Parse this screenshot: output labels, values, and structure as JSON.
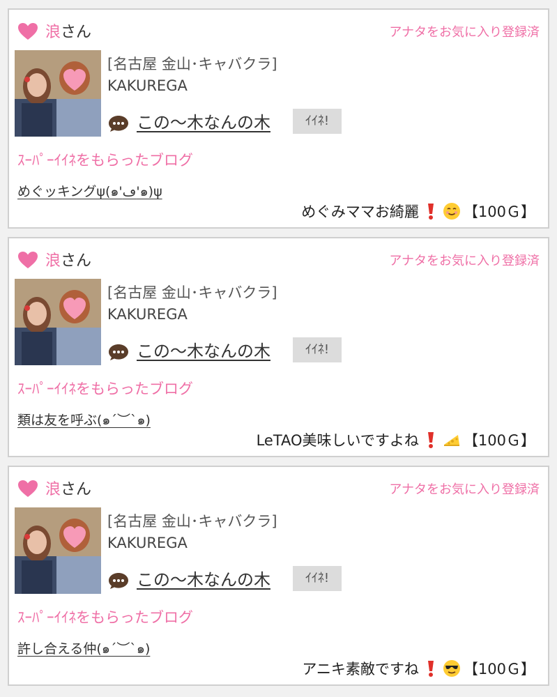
{
  "cards": [
    {
      "user_name": "浪",
      "user_suffix": "さん",
      "favorite_status": "アナタをお気に入り登録済",
      "shop_location": "[名古屋 金山･キャバクラ]",
      "shop_name": "KAKUREGA",
      "blog_title": "この〜木なんの木",
      "iine_label": "ｲｲﾈ!",
      "section_label": "ｽｰﾊﾟｰｲｲﾈをもらったブログ",
      "article_title": "めぐッキングψ(๑'ڡ'๑)ψ",
      "comment_text": "めぐみママお綺麗",
      "emoji_icons": [
        "heavy-exclamation-mark-icon",
        "smiling-face-icon"
      ],
      "points": "【100Ｇ】"
    },
    {
      "user_name": "浪",
      "user_suffix": "さん",
      "favorite_status": "アナタをお気に入り登録済",
      "shop_location": "[名古屋 金山･キャバクラ]",
      "shop_name": "KAKUREGA",
      "blog_title": "この〜木なんの木",
      "iine_label": "ｲｲﾈ!",
      "section_label": "ｽｰﾊﾟｰｲｲﾈをもらったブログ",
      "article_title": "類は友を呼ぶ(๑´︶`๑)",
      "comment_text": "LeTAO美味しいですよね",
      "emoji_icons": [
        "heavy-exclamation-mark-icon",
        "cheese-icon"
      ],
      "points": "【100Ｇ】"
    },
    {
      "user_name": "浪",
      "user_suffix": "さん",
      "favorite_status": "アナタをお気に入り登録済",
      "shop_location": "[名古屋 金山･キャバクラ]",
      "shop_name": "KAKUREGA",
      "blog_title": "この〜木なんの木",
      "iine_label": "ｲｲﾈ!",
      "section_label": "ｽｰﾊﾟｰｲｲﾈをもらったブログ",
      "article_title": "許し合える仲(๑´︶`๑)",
      "comment_text": "アニキ素敵ですね",
      "emoji_icons": [
        "heavy-exclamation-mark-icon",
        "sunglasses-face-icon"
      ],
      "points": "【100Ｇ】"
    }
  ],
  "colors": {
    "accent_pink": "#ef6fa6",
    "border": "#cfcfcf",
    "iine_bg": "#dcdcdc"
  }
}
